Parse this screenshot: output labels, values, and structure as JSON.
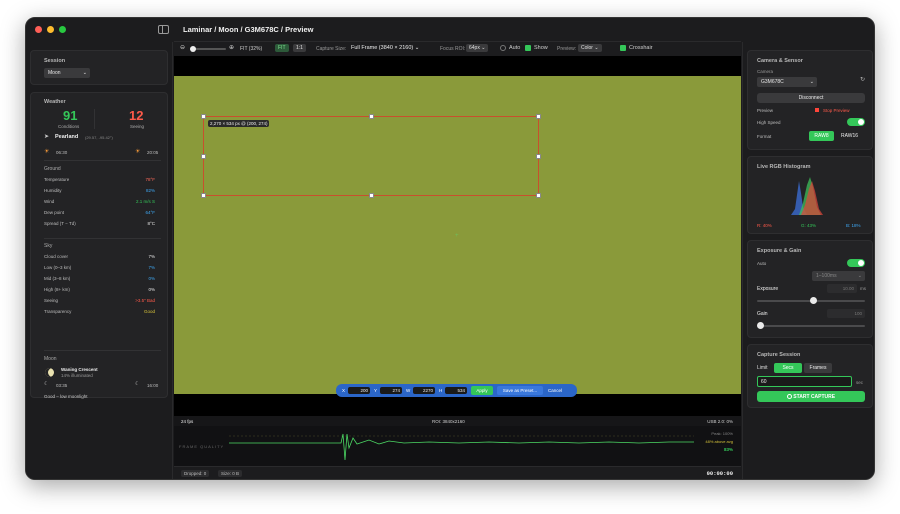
{
  "window": {
    "title": "Laminar / Moon / G3M678C / Preview"
  },
  "toolbar": {
    "zoom_label": "FIT (32%)",
    "fit_btn": "FIT",
    "one_btn": "1:1",
    "capture_size_label": "Capture Size:",
    "capture_size_value": "Full Frame (3840 × 2160)",
    "focus_roi_label": "Focus ROI:",
    "focus_roi_value": "64px",
    "auto_label": "Auto",
    "show_label": "Show",
    "preview_label": "Preview:",
    "preview_value": "Color",
    "crosshair_label": "Crosshair"
  },
  "session": {
    "title": "Session",
    "value": "Moon"
  },
  "weather": {
    "title": "Weather",
    "conditions_value": "91",
    "conditions_label": "Conditions",
    "seeing_value": "12",
    "seeing_label": "Seeing",
    "location": "Pearland",
    "coords": "(29.57, -95.42°)",
    "sunrise": "06:30",
    "sunset": "20:05",
    "ground_title": "Ground",
    "ground": [
      {
        "label": "Temperature",
        "value": "78°F",
        "color": "#ff6b5a"
      },
      {
        "label": "Humidity",
        "value": "82%",
        "color": "#3fa9f5"
      },
      {
        "label": "Wind",
        "value": "2.1 m/s S",
        "color": "#34c759"
      },
      {
        "label": "Dew point",
        "value": "64°F",
        "color": "#3fa9f5"
      },
      {
        "label": "Spread (T − Td)",
        "value": "8°C",
        "color": "#e6e6e6"
      }
    ],
    "sky_title": "Sky",
    "sky": [
      {
        "label": "Cloud cover",
        "value": "7%",
        "color": "#e6e6e6"
      },
      {
        "label": "Low (0–3 km)",
        "value": "7%",
        "color": "#3fa9f5"
      },
      {
        "label": "Mid (3–8 km)",
        "value": "0%",
        "color": "#3fa9f5"
      },
      {
        "label": "High (8+ km)",
        "value": "0%",
        "color": "#e6e6e6"
      },
      {
        "label": "Seeing",
        "value": ">3.5″  Bad",
        "color": "#ff5a4a"
      },
      {
        "label": "Transparency",
        "value": "Good",
        "color": "#d6c23a"
      }
    ],
    "moon_title": "Moon",
    "moon_phase": "Waning Crescent",
    "moon_illum": "14% illuminated",
    "moonrise": "03:35",
    "moonset": "16:00",
    "moon_note": "Good – low moonlight"
  },
  "roi": {
    "label": "2,270 × 534 px @ (200, 274)",
    "x_label": "X",
    "x": "200",
    "y_label": "Y",
    "y": "274",
    "w_label": "W",
    "w": "2270",
    "h_label": "H",
    "h": "534",
    "apply": "Apply",
    "save_preset": "Save as Preset...",
    "cancel": "Cancel"
  },
  "stats": {
    "fps": "24 fps",
    "roi": "ROI: 3840x2160",
    "usb": "USB 2.0: 0%",
    "frame_quality": "FRAME QUALITY",
    "peak": "Peak: 100%",
    "above_avg": "48% above avg",
    "current": "83%"
  },
  "bottom": {
    "dropped": "Dropped: 0",
    "size": "Size: 0 B",
    "timer": "00:00:00"
  },
  "camera": {
    "title": "Camera & Sensor",
    "camera_label": "Camera",
    "camera_value": "G3M678C",
    "disconnect": "Disconnect",
    "preview_label": "Preview",
    "stop_preview": "Stop Preview",
    "high_speed_label": "High Speed",
    "format_label": "Format",
    "format_raw8": "RAW8",
    "format_raw16": "RAW16"
  },
  "histogram": {
    "title": "Live RGB Histogram",
    "r": "R: 40%",
    "g": "G: 43%",
    "b": "B: 18%"
  },
  "exposure": {
    "title": "Exposure & Gain",
    "auto_label": "Auto",
    "range_value": "1–100ms",
    "exposure_label": "Exposure",
    "exposure_value": "10.00",
    "exposure_unit": "ms",
    "exposure_level": 0.52,
    "gain_label": "Gain",
    "gain_value": "100",
    "gain_level": 0.0
  },
  "capture": {
    "title": "Capture Session",
    "limit_label": "Limit",
    "secs": "Secs",
    "frames": "Frames",
    "duration_value": "60",
    "duration_unit": "sec",
    "start": "START CAPTURE"
  },
  "colors": {
    "accent_green": "#34c759",
    "roi_blue": "#2b66c8",
    "image_green": "#8a9a3a",
    "roi_outline": "#c8502d"
  }
}
